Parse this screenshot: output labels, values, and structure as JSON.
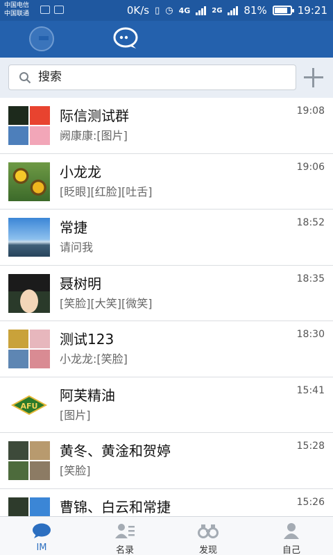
{
  "status_bar": {
    "carrier_1": "中国电信",
    "carrier_2": "中国联通",
    "speed": "0K/s",
    "net_1": "4G",
    "net_2": "2G",
    "battery_text": "81%",
    "battery_level": 0.81,
    "time": "19:21"
  },
  "search": {
    "placeholder": "搜索"
  },
  "conversations": [
    {
      "name": "际信测试群",
      "preview": "阙康康:[图片]",
      "time": "19:08"
    },
    {
      "name": "小龙龙",
      "preview": "[眨眼][红脸][吐舌]",
      "time": "19:06"
    },
    {
      "name": "常捷",
      "preview": "请问我",
      "time": "18:52"
    },
    {
      "name": "聂树明",
      "preview": "[笑脸][大笑][微笑]",
      "time": "18:35"
    },
    {
      "name": "测试123",
      "preview": "小龙龙:[笑脸]",
      "time": "18:30"
    },
    {
      "name": "阿芙精油",
      "preview": "[图片]",
      "time": "15:41"
    },
    {
      "name": "黄冬、黄淦和贺婷",
      "preview": "[笑脸]",
      "time": "15:28"
    },
    {
      "name": "曹锦、白云和常捷",
      "preview": "",
      "time": "15:26"
    }
  ],
  "afu_logo_text": "AFU",
  "tabs": [
    {
      "label": "IM",
      "icon": "chat-bubble-icon"
    },
    {
      "label": "名录",
      "icon": "contacts-icon"
    },
    {
      "label": "发现",
      "icon": "binoculars-icon"
    },
    {
      "label": "自己",
      "icon": "person-icon"
    }
  ],
  "colors": {
    "header": "#2461ad",
    "status_bar": "#1f58a0",
    "accent": "#2c6fc0"
  }
}
